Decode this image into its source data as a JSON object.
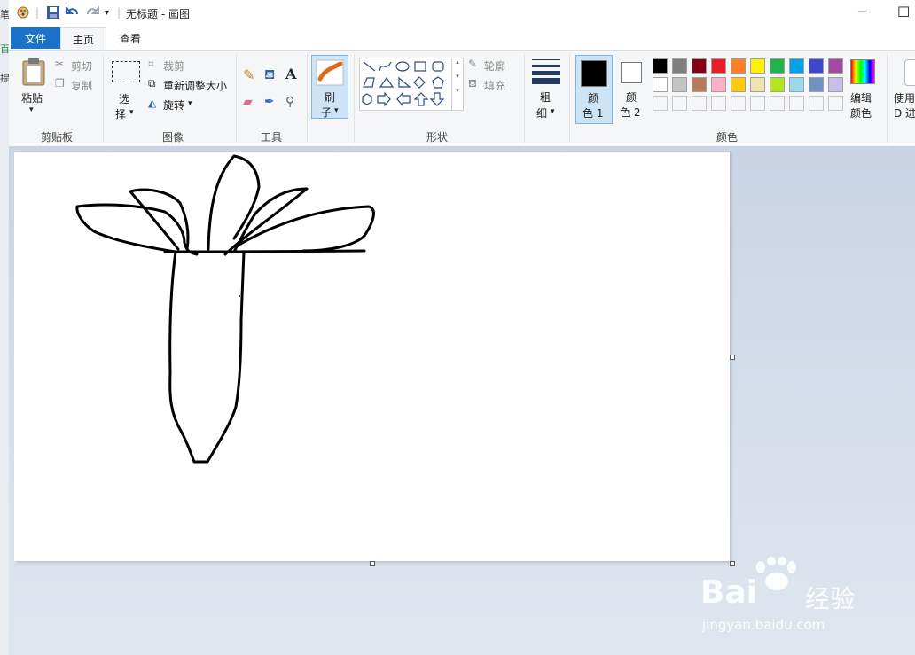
{
  "window": {
    "title": "无标题 - 画图",
    "left_fragments": [
      "笔",
      "百",
      "提"
    ]
  },
  "tabs": {
    "file": "文件",
    "home": "主页",
    "view": "查看"
  },
  "clipboard": {
    "paste": "粘贴",
    "cut": "剪切",
    "copy": "复制",
    "label": "剪贴板"
  },
  "image": {
    "select_1": "选",
    "select_2": "择",
    "crop": "裁剪",
    "resize": "重新调整大小",
    "rotate": "旋转",
    "label": "图像"
  },
  "tools": {
    "label": "工具",
    "text_glyph": "A"
  },
  "brush": {
    "line1": "刷",
    "line2": "子"
  },
  "shapes": {
    "outline": "轮廓",
    "fill": "填充",
    "label": "形状"
  },
  "size": {
    "line1": "粗",
    "line2": "细"
  },
  "color1": {
    "line1": "颜",
    "line2": "色 1",
    "value": "#000000"
  },
  "color2": {
    "line1": "颜",
    "line2": "色 2",
    "value": "#ffffff"
  },
  "colors": {
    "label": "颜色",
    "edit_1": "编辑",
    "edit_2": "颜色",
    "palette_row1": [
      "#000000",
      "#7f7f7f",
      "#880015",
      "#ed1c24",
      "#ff7f27",
      "#fff200",
      "#22b14c",
      "#00a2e8",
      "#3f48cc",
      "#a349a4"
    ],
    "palette_row2": [
      "#ffffff",
      "#c3c3c3",
      "#b97a57",
      "#ffaec9",
      "#ffc90e",
      "#efe4b0",
      "#b5e61d",
      "#99d9ea",
      "#7092be",
      "#c8bfe7"
    ]
  },
  "paint3d": {
    "line1": "使用",
    "line2": "D 进"
  },
  "watermark": {
    "brand": "Bai",
    "brand_cn": "经验",
    "url": "jingyan.baidu.com"
  }
}
